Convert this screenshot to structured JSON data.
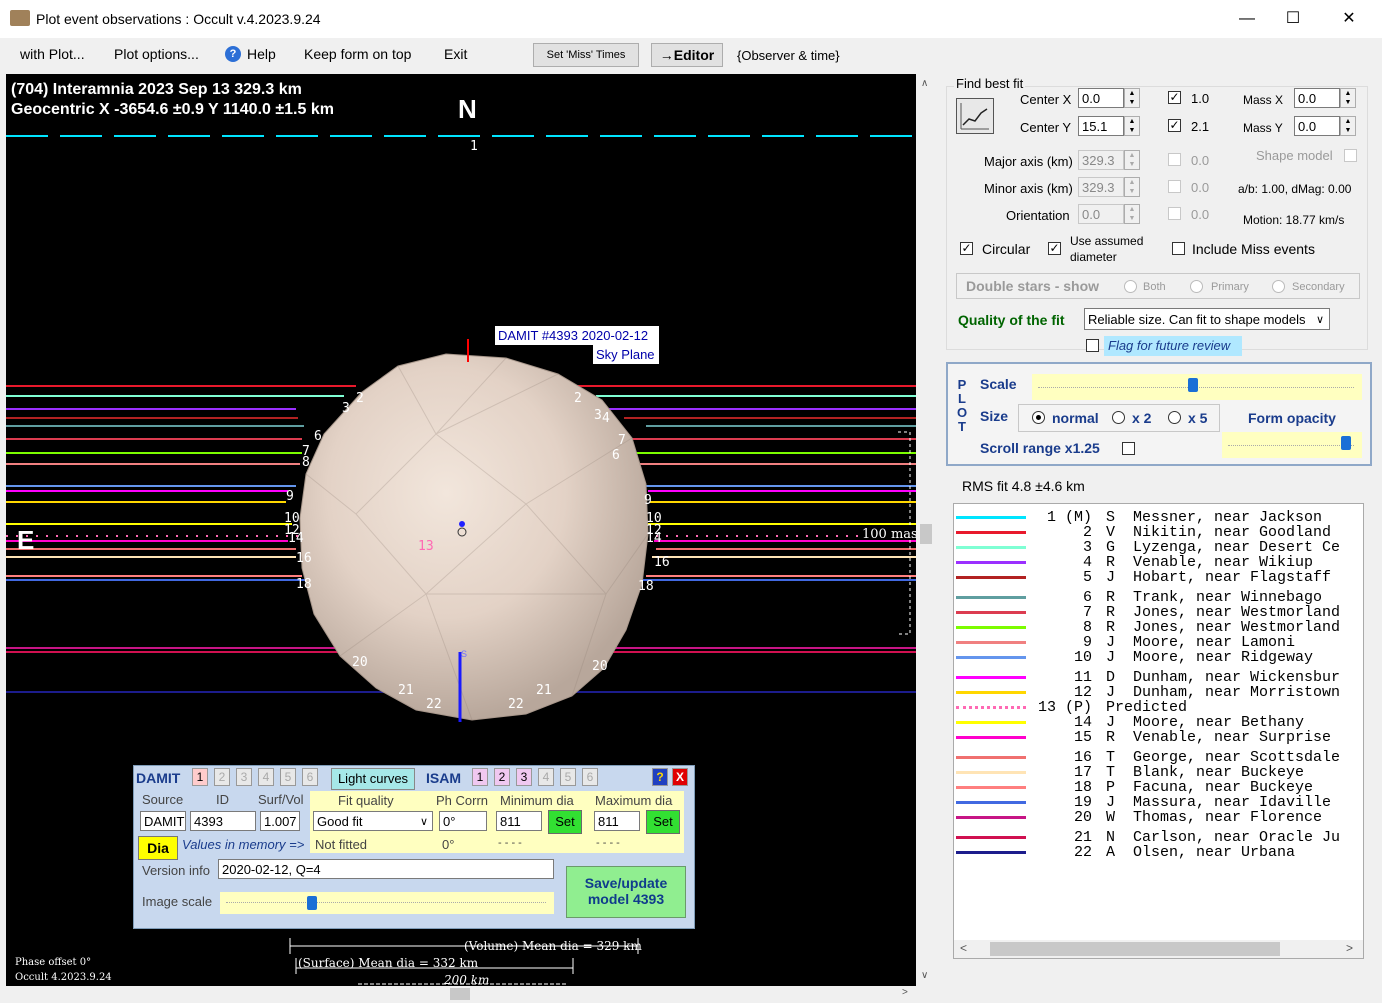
{
  "window": {
    "title": "Plot event observations : Occult v.4.2023.9.24",
    "controls": {
      "minimize": "—",
      "maximize": "☐",
      "close": "✕"
    }
  },
  "menu": {
    "items": [
      "with Plot...",
      "Plot options...",
      "Help",
      "Keep form on top",
      "Exit"
    ],
    "set_miss_times": "Set 'Miss' Times",
    "editor": "→Editor",
    "observer_time": "{Observer & time}"
  },
  "plot": {
    "header_line1": "(704) Interamnia  2023 Sep 13   329.3 km",
    "header_line2": "Geocentric  X  -3654.6 ±0.9  Y  1140.0 ±1.5 km",
    "north": "N",
    "east": "E",
    "model_label_1": "DAMIT #4393 2020-02-12",
    "model_label_2": "Sky Plane",
    "scale_mas": "100 mas",
    "south_mark": "S",
    "volume_dia": "(Volume) Mean dia = 329 km",
    "surface_dia": "(Surface) Mean dia = 332 km",
    "scale_km": "200 km",
    "phase_offset": "Phase offset 0°",
    "version": "Occult 4.2023.9.24",
    "chord_labels": [
      "1",
      "2",
      "3",
      "2",
      "3",
      "4",
      "6",
      "7",
      "6",
      "7",
      "8",
      "9",
      "9",
      "10",
      "10",
      "12",
      "12",
      "14",
      "14",
      "16",
      "16",
      "13",
      "18",
      "18",
      "20",
      "20",
      "21",
      "21",
      "22",
      "22"
    ]
  },
  "fit": {
    "group_title": "Find best fit",
    "center_x_label": "Center X",
    "center_x": "0.0",
    "center_y_label": "Center Y",
    "center_y": "15.1",
    "wx": "1.0",
    "wy": "2.1",
    "mass_x_label": "Mass X",
    "mass_x": "0.0",
    "mass_y_label": "Mass Y",
    "mass_y": "0.0",
    "major_label": "Major axis (km)",
    "major": "329.3",
    "minor_label": "Minor axis (km)",
    "minor": "329.3",
    "orient_label": "Orientation",
    "orient": "0.0",
    "w_major": "0.0",
    "w_minor": "0.0",
    "w_orient": "0.0",
    "shape_model": "Shape model",
    "ab_dmag": "a/b: 1.00, dMag: 0.00",
    "motion": "Motion: 18.77 km/s",
    "circular": "Circular",
    "use_assumed_1": "Use assumed",
    "use_assumed_2": "diameter",
    "include_miss": "Include Miss events",
    "double_stars": "Double stars - show",
    "both": "Both",
    "primary": "Primary",
    "secondary": "Secondary",
    "quality_label": "Quality of the fit",
    "quality_value": "Reliable size. Can fit to shape models",
    "flag_review": "Flag for future review"
  },
  "plotbox": {
    "side_label": [
      "P",
      "L",
      "O",
      "T"
    ],
    "scale": "Scale",
    "size": "Size",
    "normal": "normal",
    "x2": "x 2",
    "x5": "x 5",
    "form_opacity": "Form opacity",
    "scroll_range": "Scroll range x1.25",
    "scale_level": 0.49,
    "opacity_level": 0.97
  },
  "rms": "RMS fit 4.8 ±4.6 km",
  "observers": [
    {
      "num": "1 (M)",
      "text": "S  Messner, near Jackson",
      "color": "#00e5ff",
      "style": "solid"
    },
    {
      "num": "2",
      "text": "V  Nikitin, near Goodland",
      "color": "#e8192c",
      "style": "solid"
    },
    {
      "num": "3",
      "text": "G  Lyzenga, near Desert Ce",
      "color": "#7fffd4",
      "style": "solid"
    },
    {
      "num": "4",
      "text": "R  Venable, near Wikiup",
      "color": "#9b30ff",
      "style": "solid"
    },
    {
      "num": "5",
      "text": "J  Hobart, near Flagstaff",
      "color": "#b22222",
      "style": "solid"
    },
    {
      "num": "6",
      "text": "R  Trank, near Winnebago",
      "color": "#5f9ea0",
      "style": "solid"
    },
    {
      "num": "7",
      "text": "R  Jones, near Westmorland",
      "color": "#dc3c50",
      "style": "solid"
    },
    {
      "num": "8",
      "text": "R  Jones, near Westmorland",
      "color": "#7cfc00",
      "style": "solid"
    },
    {
      "num": "9",
      "text": "J  Moore, near Lamoni",
      "color": "#f08080",
      "style": "solid"
    },
    {
      "num": "10",
      "text": "J  Moore, near Ridgeway",
      "color": "#6495ed",
      "style": "solid"
    },
    {
      "num": "11",
      "text": "D  Dunham, near Wickensbur",
      "color": "#ff00ff",
      "style": "solid"
    },
    {
      "num": "12",
      "text": "J  Dunham, near Morristown",
      "color": "#ffd700",
      "style": "solid"
    },
    {
      "num": "13 (P)",
      "text": "Predicted",
      "color": "#ff69b4",
      "style": "dotted"
    },
    {
      "num": "14",
      "text": "J  Moore, near Bethany",
      "color": "#ffff00",
      "style": "solid"
    },
    {
      "num": "15",
      "text": "R  Venable, near Surprise",
      "color": "#ff00cc",
      "style": "solid"
    },
    {
      "num": "16",
      "text": "T  George, near Scottsdale",
      "color": "#f07070",
      "style": "solid"
    },
    {
      "num": "17",
      "text": "T  Blank, near Buckeye",
      "color": "#ffe4b5",
      "style": "solid"
    },
    {
      "num": "18",
      "text": "P  Facuna, near Buckeye",
      "color": "#ff7f7f",
      "style": "solid"
    },
    {
      "num": "19",
      "text": "J  Massura, near Idaville",
      "color": "#4169e1",
      "style": "solid"
    },
    {
      "num": "20",
      "text": "W  Thomas, near Florence",
      "color": "#c71585",
      "style": "solid"
    },
    {
      "num": "21",
      "text": "N  Carlson, near Oracle Ju",
      "color": "#d01050",
      "style": "solid"
    },
    {
      "num": "22",
      "text": "A  Olsen, near Urbana",
      "color": "#1c1c8c",
      "style": "solid"
    }
  ],
  "damit": {
    "damit_label": "DAMIT",
    "damit_tabs": [
      "1",
      "2",
      "3",
      "4",
      "5",
      "6"
    ],
    "light_curves": "Light curves",
    "isam_label": "ISAM",
    "isam_tabs": [
      "1",
      "2",
      "3",
      "4",
      "5",
      "6"
    ],
    "help": "?",
    "close": "X",
    "col_source": "Source",
    "col_id": "ID",
    "col_surf": "Surf/Vol",
    "col_fit": "Fit quality",
    "col_ph": "Ph Corrn",
    "col_min": "Minimum dia",
    "col_max": "Maximum dia",
    "source": "DAMIT",
    "id": "4393",
    "surf": "1.007",
    "fit_quality": "Good fit",
    "ph_corr": "0°",
    "min_dia": "811",
    "max_dia": "811",
    "set": "Set",
    "dia": "Dia",
    "values_in_memory": "Values in memory =>",
    "not_fitted": "Not fitted",
    "ph_mem": "0°",
    "dash1": "- - - -",
    "dash2": "- - - -",
    "version_label": "Version info",
    "version_value": "2020-02-12, Q=4",
    "image_scale": "Image scale",
    "image_scale_level": 0.26,
    "save_1": "Save/update",
    "save_2": "model 4393"
  }
}
